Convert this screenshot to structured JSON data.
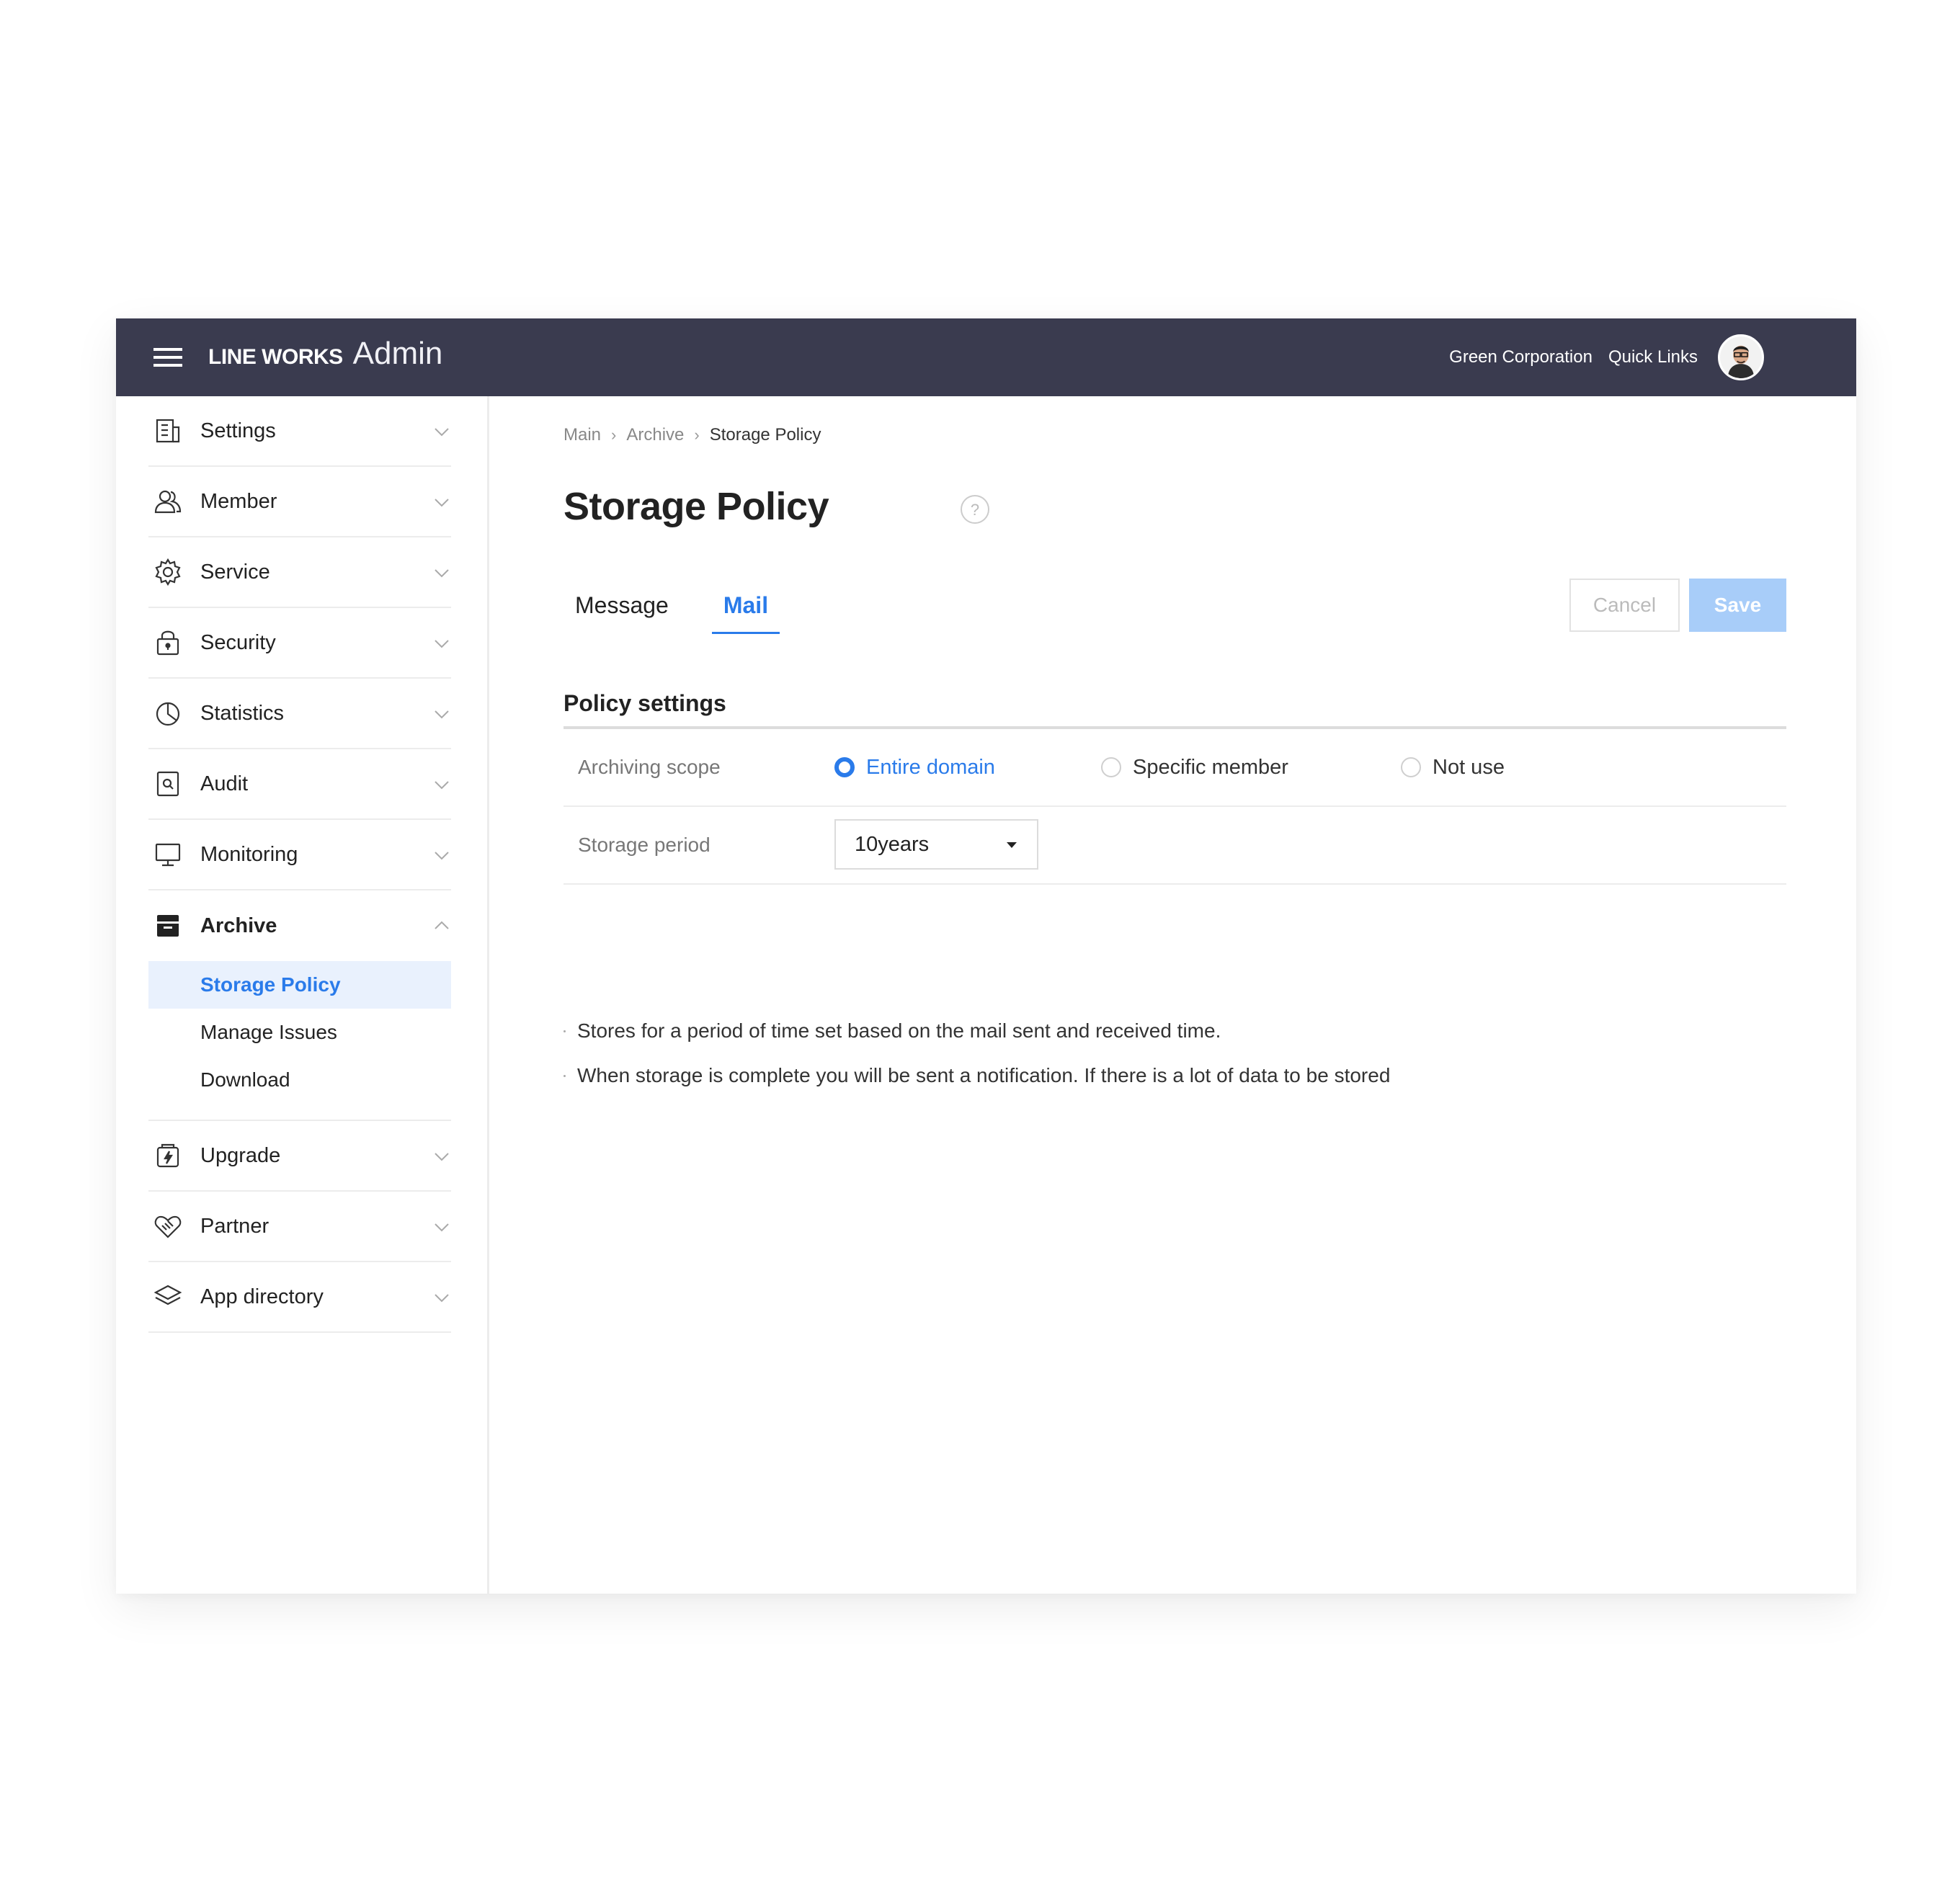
{
  "header": {
    "brand_main": "LINE WORKS",
    "brand_sub": "Admin",
    "company": "Green Corporation",
    "quick_links": "Quick Links",
    "bg_color": "#3a3b4f"
  },
  "sidebar": {
    "items": [
      {
        "label": "Settings",
        "icon": "building-icon"
      },
      {
        "label": "Member",
        "icon": "users-icon"
      },
      {
        "label": "Service",
        "icon": "gear-icon"
      },
      {
        "label": "Security",
        "icon": "lock-icon"
      },
      {
        "label": "Statistics",
        "icon": "pie-chart-icon"
      },
      {
        "label": "Audit",
        "icon": "document-search-icon"
      },
      {
        "label": "Monitoring",
        "icon": "monitor-icon"
      },
      {
        "label": "Archive",
        "icon": "archive-icon",
        "expanded": true
      },
      {
        "label": "Upgrade",
        "icon": "upgrade-icon"
      },
      {
        "label": "Partner",
        "icon": "handshake-icon"
      },
      {
        "label": "App directory",
        "icon": "layers-icon"
      }
    ],
    "archive_sub": [
      {
        "label": "Storage Policy",
        "active": true
      },
      {
        "label": "Manage Issues"
      },
      {
        "label": "Download"
      }
    ]
  },
  "breadcrumb": [
    "Main",
    "Archive",
    "Storage Policy"
  ],
  "page": {
    "title": "Storage Policy",
    "tabs": [
      {
        "label": "Message"
      },
      {
        "label": "Mail",
        "active": true
      }
    ],
    "cancel_label": "Cancel",
    "save_label": "Save",
    "section_title": "Policy settings"
  },
  "policy": {
    "scope_label": "Archiving scope",
    "scope_options": [
      {
        "label": "Entire domain",
        "checked": true
      },
      {
        "label": "Specific member"
      },
      {
        "label": "Not use"
      }
    ],
    "period_label": "Storage period",
    "period_value": "10years"
  },
  "notes": [
    "Stores for a period of time set based on the mail sent and received time.",
    "When storage is complete you will be sent a notification. If there is a lot of data to be stored"
  ],
  "colors": {
    "accent": "#2a7bea",
    "save_disabled": "#a8cdf9",
    "active_bg": "#e9f1fd"
  }
}
